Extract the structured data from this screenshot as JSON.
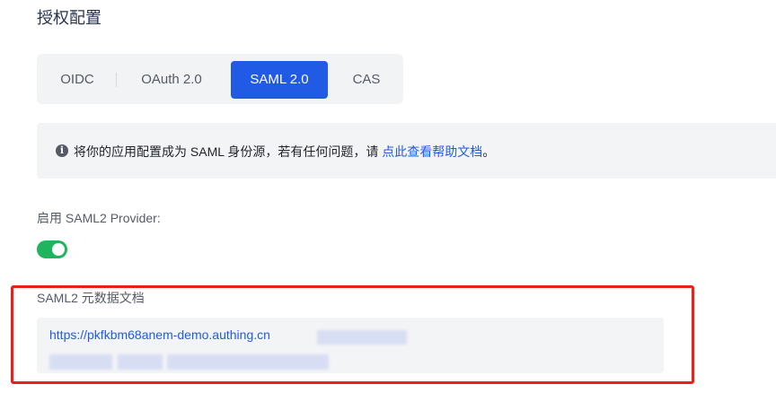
{
  "page": {
    "title": "授权配置"
  },
  "tabs": [
    {
      "label": "OIDC",
      "active": false
    },
    {
      "label": "OAuth 2.0",
      "active": false
    },
    {
      "label": "SAML 2.0",
      "active": true
    },
    {
      "label": "CAS",
      "active": false
    }
  ],
  "notice": {
    "icon": "info-circle-icon",
    "text": "将你的应用配置成为 SAML 身份源，若有任何问题，请 ",
    "link_text": "点此查看帮助文档",
    "suffix": "。"
  },
  "provider": {
    "label": "启用 SAML2 Provider:",
    "enabled": true
  },
  "metadata": {
    "label": "SAML2 元数据文档",
    "url": "https://pkfkbm68anem-demo.authing.cn"
  },
  "colors": {
    "accent": "#215ae5",
    "toggle_on": "#1fb45e",
    "highlight_border": "#e8201a"
  }
}
